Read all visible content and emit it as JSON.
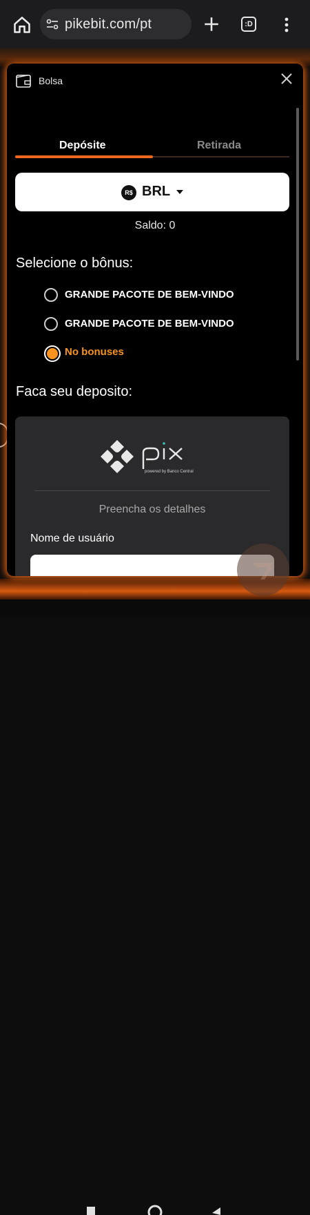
{
  "browser": {
    "url": "pikebit.com/pt",
    "tabs_label": ":D"
  },
  "modal": {
    "title": "Bolsa",
    "tabs": [
      {
        "label": "Depósite",
        "active": true
      },
      {
        "label": "Retirada",
        "active": false
      }
    ],
    "currency": {
      "badge": "R$",
      "code": "BRL"
    },
    "balance_text": "Saldo: 0",
    "bonus_heading": "Selecione o bônus:",
    "bonuses": [
      {
        "label": "GRANDE PACOTE DE BEM-VINDO",
        "selected": false
      },
      {
        "label": "GRANDE PACOTE DE BEM-VINDO",
        "selected": false
      },
      {
        "label": "No bonuses",
        "selected": true
      }
    ],
    "deposit_heading": "Faca seu deposito:",
    "pix": {
      "subtitle": "powered by Banco Central",
      "details_text": "Preencha os detalhes",
      "username_label": "Nome de usuário",
      "username_value": ""
    }
  },
  "colors": {
    "accent": "#f0661e",
    "selected_radio": "#f7931e",
    "modal_bg": "#000000",
    "card_bg": "#2a2a2c"
  }
}
